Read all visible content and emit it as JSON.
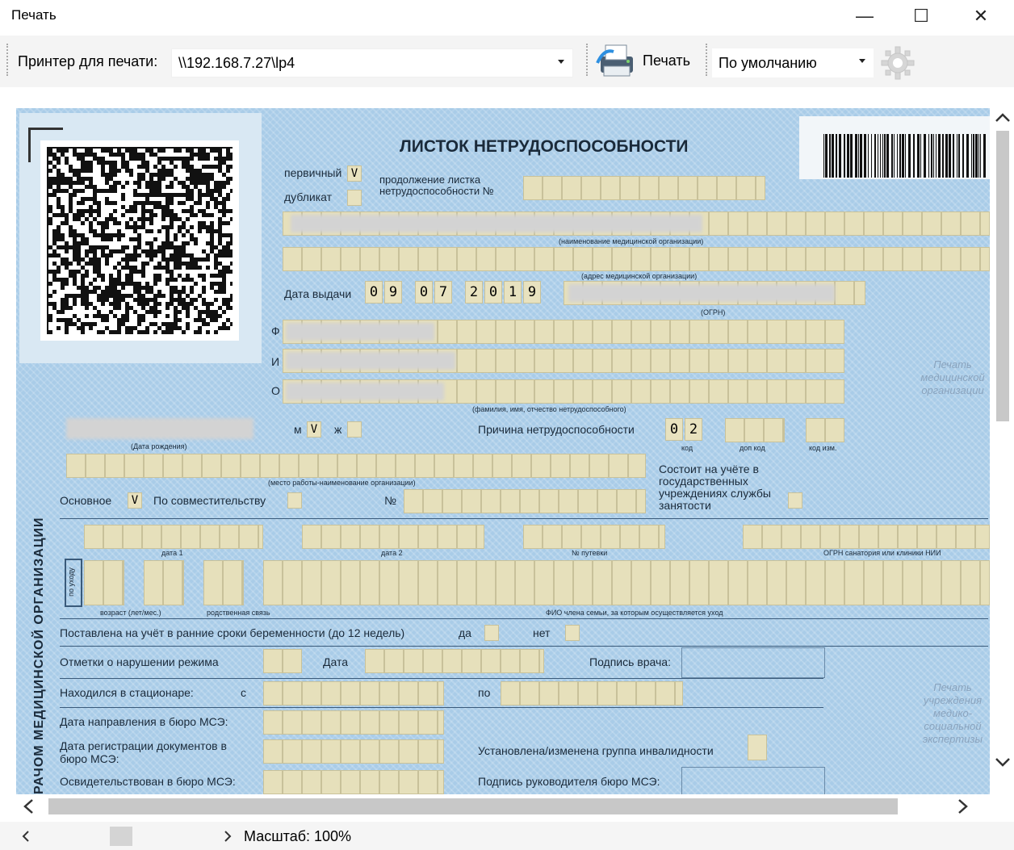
{
  "window": {
    "title": "Печать",
    "minimize": "—",
    "maximize": "☐",
    "close": "✕"
  },
  "toolbar": {
    "printer_label": "Принтер для печати:",
    "printer_value": "\\\\192.168.7.27\\lp4",
    "print_label": "Печать",
    "preset_value": "По умолчанию"
  },
  "form": {
    "title": "ЛИСТОК НЕТРУДОСПОСОБНОСТИ",
    "primary_label": "первичный",
    "primary_mark": "V",
    "duplicate_label": "дубликат",
    "continuation_label": "продолжение листка нетрудоспособности №",
    "org_name_caption": "(наименование медицинской организации)",
    "org_address_caption": "(адрес медицинской организации)",
    "issue_date_label": "Дата выдачи",
    "issue_date_digits": [
      "0",
      "9",
      "0",
      "7",
      "2",
      "0",
      "1",
      "9"
    ],
    "ogrn_caption": "(ОГРН)",
    "f_label": "Ф",
    "i_label": "И",
    "o_label": "О",
    "fio_caption": "(фамилия, имя, отчество нетрудоспособного)",
    "stamp_medorg": "Печать медицинской организации",
    "birth_caption": "(Дата рождения)",
    "m_label": "м",
    "m_mark": "V",
    "zh_label": "ж",
    "reason_label": "Причина нетрудоспособности",
    "reason_digits": [
      "0",
      "2"
    ],
    "kod_caption": "код",
    "dop_kod_caption": "доп код",
    "kod_izm_caption": "код изм.",
    "workplace_caption": "(место работы-наименование организации)",
    "registered_label": "Состоит на учёте в государственных учреждениях службы занятости",
    "main_label": "Основное",
    "main_mark": "V",
    "part_time_label": "По совместительству",
    "num_label": "№",
    "date1_caption": "дата 1",
    "date2_caption": "дата 2",
    "voucher_caption": "№ путевки",
    "sanatorium_caption": "ОГРН санатория или клиники НИИ",
    "care_label": "по уходу",
    "age_caption": "возраст (лет/мес.)",
    "relation_caption": "родственная связь",
    "family_caption": "ФИО члена семьи, за которым осуществляется уход",
    "pregnancy_label": "Поставлена на учёт в ранние сроки беременности (до 12 недель)",
    "yes_label": "да",
    "no_label": "нет",
    "violations_label": "Отметки о нарушении режима",
    "date_label": "Дата",
    "doctor_sign_label": "Подпись врача:",
    "hospital_label": "Находился в стационаре:",
    "from_label": "с",
    "to_label": "по",
    "mse_direction_label": "Дата направления в бюро МСЭ:",
    "mse_registration_label": "Дата регистрации документов в бюро МСЭ:",
    "disability_label": "Установлена/изменена группа инвалидности",
    "mse_exam_label": "Освидетельствован в бюро МСЭ:",
    "mse_head_sign_label": "Подпись руководителя бюро МСЭ:",
    "stamp_mse": "Печать учреждения медико-социальной экспертизы",
    "side_label": "РАЧОМ МЕДИЦИНСКОЙ ОРГАНИЗАЦИИ"
  },
  "status": {
    "zoom": "Масштаб: 100%"
  }
}
